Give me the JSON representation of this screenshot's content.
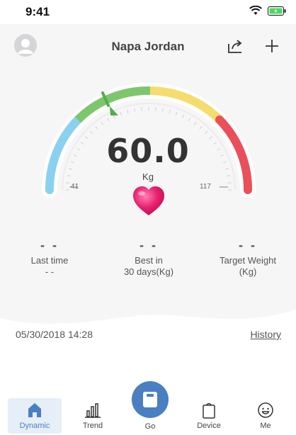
{
  "status_bar": {
    "time": "9:41",
    "icons": [
      "wifi-icon",
      "battery-icon"
    ]
  },
  "header": {
    "user_name": "Napa Jordan",
    "avatar_icon": "avatar-icon",
    "share_icon": "share-icon",
    "add_icon": "plus-icon"
  },
  "gauge": {
    "weight": "60.0",
    "unit": "Kg",
    "min_label": "41",
    "max_label": "117",
    "colors": {
      "blue": "#8ad0ef",
      "green": "#7ec66c",
      "yellow": "#f5dc6e",
      "red": "#e9505a"
    },
    "indicator_color": "#4fae4a",
    "heart_icon": "heart-icon"
  },
  "stats": [
    {
      "value": "- -",
      "label": "Last time",
      "sub": "- -"
    },
    {
      "value": "- -",
      "label": "Best in",
      "sub": "30 days(Kg)"
    },
    {
      "value": "- -",
      "label": "Target Weight",
      "sub": "(Kg)"
    }
  ],
  "record": {
    "datetime": "05/30/2018 14:28",
    "history_label": "History"
  },
  "tabbar": {
    "accent": "#4a7fc1",
    "tabs": [
      {
        "label": "Dynamic",
        "icon": "home-icon",
        "active": true
      },
      {
        "label": "Trend",
        "icon": "bar-chart-icon",
        "active": false
      },
      {
        "label": "Go",
        "icon": "scale-icon",
        "active": false
      },
      {
        "label": "Device",
        "icon": "bag-icon",
        "active": false
      },
      {
        "label": "Me",
        "icon": "smiley-icon",
        "active": false
      }
    ]
  }
}
